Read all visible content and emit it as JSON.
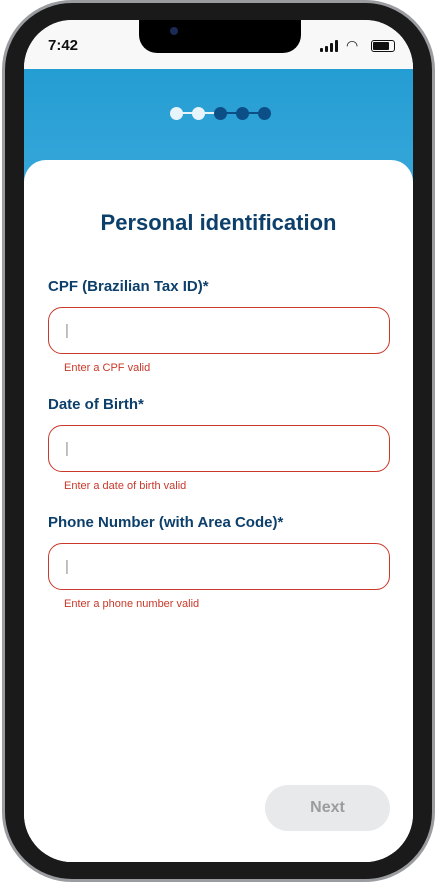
{
  "status_bar": {
    "time": "7:42"
  },
  "stepper": {
    "total": 5,
    "current": 2,
    "active_color": "#e8f4fb",
    "inactive_color": "#0c4f86"
  },
  "form": {
    "title": "Personal identification",
    "fields": [
      {
        "label": "CPF (Brazilian Tax ID)*",
        "placeholder": "|",
        "error": "Enter a CPF valid"
      },
      {
        "label": "Date of Birth*",
        "placeholder": "|",
        "error": "Enter a date of birth valid"
      },
      {
        "label": "Phone Number (with Area Code)*",
        "placeholder": "|",
        "error": "Enter a phone number valid"
      }
    ],
    "next_label": "Next"
  }
}
